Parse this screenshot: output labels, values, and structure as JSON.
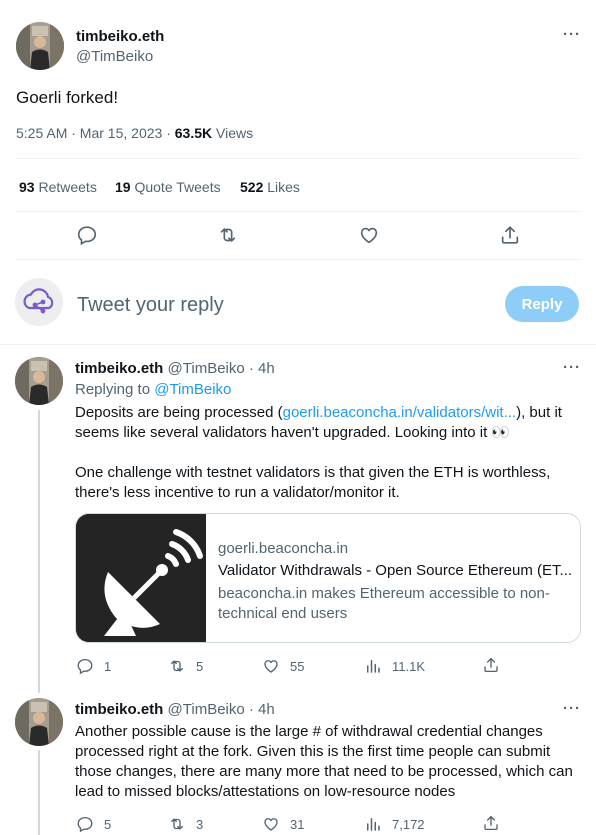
{
  "main_tweet": {
    "display_name": "timbeiko.eth",
    "handle": "@TimBeiko",
    "text": "Goerli forked!",
    "time": "5:25 AM · Mar 15, 2023 · ",
    "views_count": "63.5K",
    "views_label": " Views",
    "retweets_count": "93",
    "retweets_label": " Retweets",
    "quote_count": "19",
    "quote_label": " Quote Tweets",
    "likes_count": "522",
    "likes_label": " Likes",
    "more": "···"
  },
  "composer": {
    "placeholder": "Tweet your reply",
    "reply_button": "Reply"
  },
  "reply1": {
    "display_name": "timbeiko.eth",
    "handle_time": "@TimBeiko · 4h",
    "replying_prefix": "Replying to ",
    "replying_to": "@TimBeiko",
    "line1_a": "Deposits are being processed (",
    "line1_link": "goerli.beaconcha.in/validators/wit...",
    "line1_b": "), but it",
    "line2": "seems like several validators haven't upgraded. Looking into it 👀",
    "line3": "One challenge with testnet validators is that given the ETH is worthless,",
    "line4": "there's less incentive to run a validator/monitor it.",
    "card_domain": "goerli.beaconcha.in",
    "card_title": "Validator Withdrawals - Open Source Ethereum (ET...",
    "card_desc_1": "beaconcha.in makes Ethereum accessible to non-",
    "card_desc_2": "technical end users",
    "replies": "1",
    "retweets": "5",
    "likes": "55",
    "views": "11.1K",
    "more": "···"
  },
  "reply2": {
    "display_name": "timbeiko.eth",
    "handle_time": "@TimBeiko · 4h",
    "line1": "Another possible cause is the large # of withdrawal credential changes",
    "line2": "processed right at the fork. Given this is the first time people can submit",
    "line3": "those changes, there are many more that need to be processed, which can",
    "line4": "lead to missed blocks/attestations on low-resource nodes",
    "replies": "5",
    "retweets": "3",
    "likes": "31",
    "views": "7,172",
    "more": "···"
  },
  "colors": {
    "accent": "#1d9bf0",
    "muted": "#536471",
    "reply_button": "#8ecdf8"
  },
  "icons": [
    "reply-icon",
    "retweet-icon",
    "like-icon",
    "share-icon",
    "views-icon",
    "more-icon",
    "cloud-network-icon",
    "satellite-dish-icon"
  ]
}
